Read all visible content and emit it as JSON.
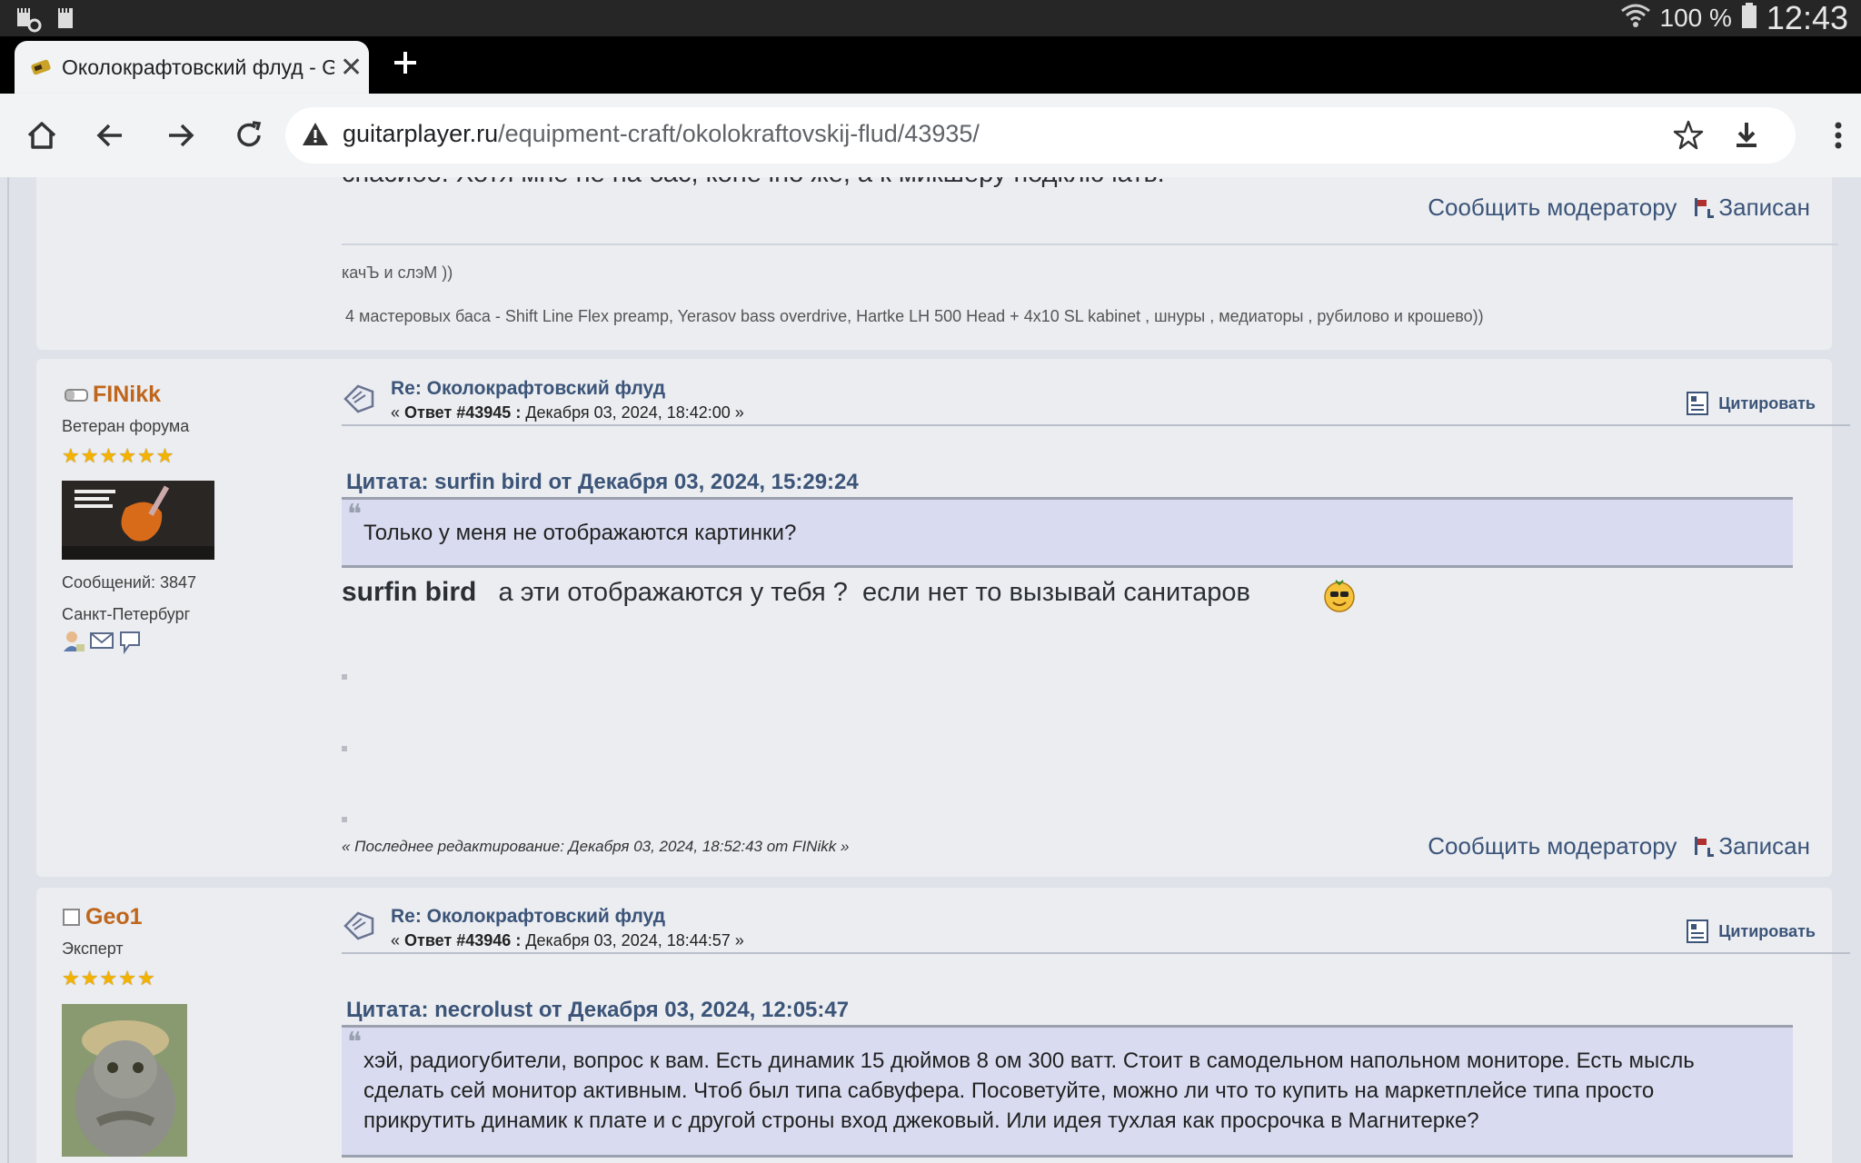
{
  "status_bar": {
    "battery": "100 %",
    "time": "12:43"
  },
  "browser": {
    "tab_title": "Околокрафтовский флуд - Gu",
    "url_host": "guitarplayer.ru",
    "url_path": "/equipment-craft/okolokraftovskij-flud/43935/"
  },
  "prev_post": {
    "text_partial": "спасибо. Хотя мне не на бас, конечно же, а к микшеру подключать.",
    "report_label": "Сообщить модератору",
    "logged_label": "Записан",
    "sig_line1": "качЪ и слэМ ))",
    "sig_line2": "4 мастеровых баса - Shift Line Flex preamp, Yerasov bass overdrive, Hartke LH 500 Head + 4x10 SL  kabinet  , шнуры , медиаторы , рубилово и крошево))"
  },
  "post1": {
    "author": "FINikk",
    "rank": "Ветеран форума",
    "stars": 6,
    "posts_count": "Сообщений: 3847",
    "location": "Санкт-Петербург",
    "title": "Re: Околокрафтовский флуд",
    "reply_prefix": "« ",
    "reply_label": "Ответ #43945 :",
    "reply_date": " Декабря 03, 2024, 18:42:00 »",
    "cite_label": "Цитировать",
    "quote_header": "Цитата: surfin bird от Декабря 03, 2024, 15:29:24",
    "quote_text": "Только у меня не отображаются картинки?",
    "body_bold": "surfin bird",
    "body_text": "   а эти отображаются у тебя ?  если нет то вызывай санитаров ",
    "last_edit": "« Последнее редактирование: Декабря 03, 2024, 18:52:43 от FINikk »",
    "report_label": "Сообщить модератору",
    "logged_label": "Записан"
  },
  "post2": {
    "author": "Geo1",
    "rank": "Эксперт",
    "stars": 5,
    "title": "Re: Околокрафтовский флуд",
    "reply_prefix": "« ",
    "reply_label": "Ответ #43946 :",
    "reply_date": " Декабря 03, 2024, 18:44:57 »",
    "cite_label": "Цитировать",
    "quote_header": "Цитата: necrolust от Декабря 03, 2024, 12:05:47",
    "quote_line1": "хэй, радиогубители, вопрос к вам. Есть динамик 15 дюймов 8 ом 300 ватт. Стоит в самодельном напольном мониторе. Есть мысль",
    "quote_line2": "сделать сей монитор активным. Чтоб был типа сабвуфера. Посоветуйте, можно ли что то купить на маркетплейсе типа просто",
    "quote_line3": "прикрутить динамик к плате и с другой строны вход джековый. Или идея тухлая как  просрочка в Магнитерке?"
  },
  "colors": {
    "accent": "#3b5478",
    "author": "#c0661c",
    "quote_bg": "#d9dcf0"
  }
}
